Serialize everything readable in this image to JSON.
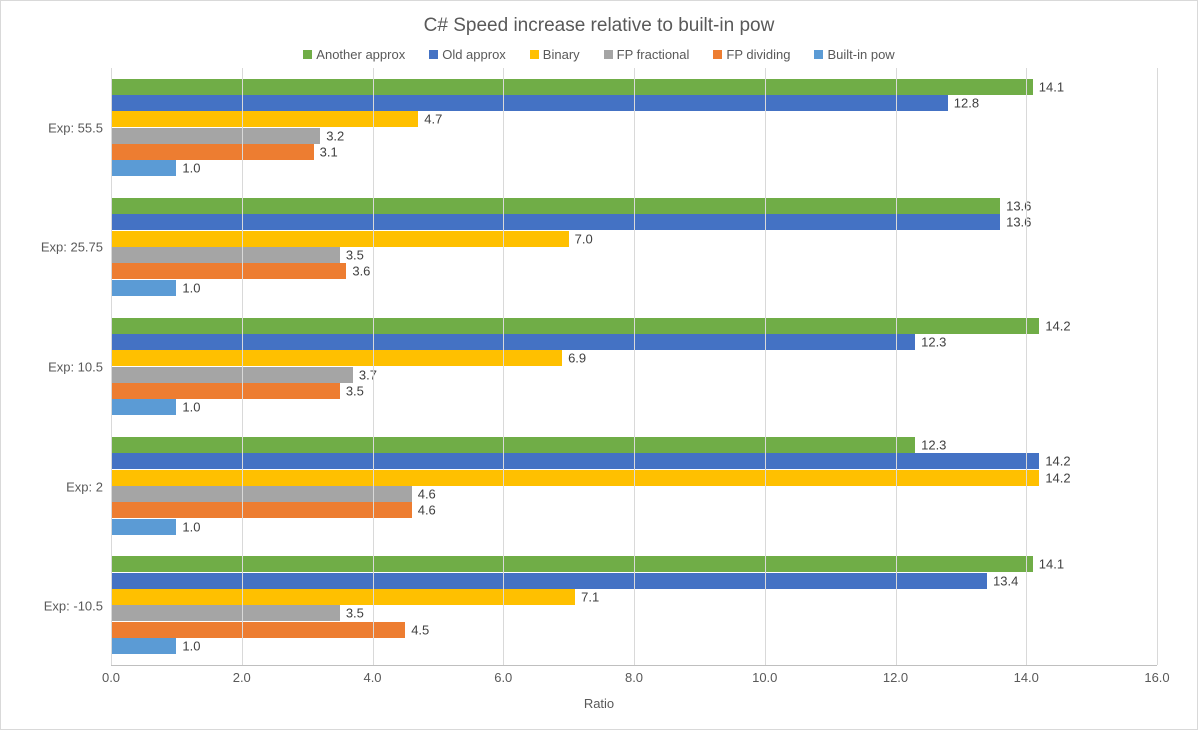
{
  "chart_data": {
    "type": "bar",
    "orientation": "horizontal",
    "title": "C# Speed increase relative to built-in pow",
    "xlabel": "Ratio",
    "ylabel": "",
    "xlim": [
      0,
      16
    ],
    "xticks": [
      0.0,
      2.0,
      4.0,
      6.0,
      8.0,
      10.0,
      12.0,
      14.0,
      16.0
    ],
    "categories": [
      "Exp: 55.5",
      "Exp: 25.75",
      "Exp: 10.5",
      "Exp: 2",
      "Exp: -10.5"
    ],
    "series": [
      {
        "name": "Another approx",
        "color": "#70AD47",
        "values": [
          14.1,
          13.6,
          14.2,
          12.3,
          14.1
        ]
      },
      {
        "name": "Old approx",
        "color": "#4472C4",
        "values": [
          12.8,
          13.6,
          12.3,
          14.2,
          13.4
        ]
      },
      {
        "name": "Binary",
        "color": "#FFC000",
        "values": [
          4.7,
          7.0,
          6.9,
          14.2,
          7.1
        ]
      },
      {
        "name": "FP fractional",
        "color": "#A5A5A5",
        "values": [
          3.2,
          3.5,
          3.7,
          4.6,
          3.5
        ]
      },
      {
        "name": "FP dividing",
        "color": "#ED7D31",
        "values": [
          3.1,
          3.6,
          3.5,
          4.6,
          4.5
        ]
      },
      {
        "name": "Built-in pow",
        "color": "#5B9BD5",
        "values": [
          1.0,
          1.0,
          1.0,
          1.0,
          1.0
        ]
      }
    ]
  }
}
